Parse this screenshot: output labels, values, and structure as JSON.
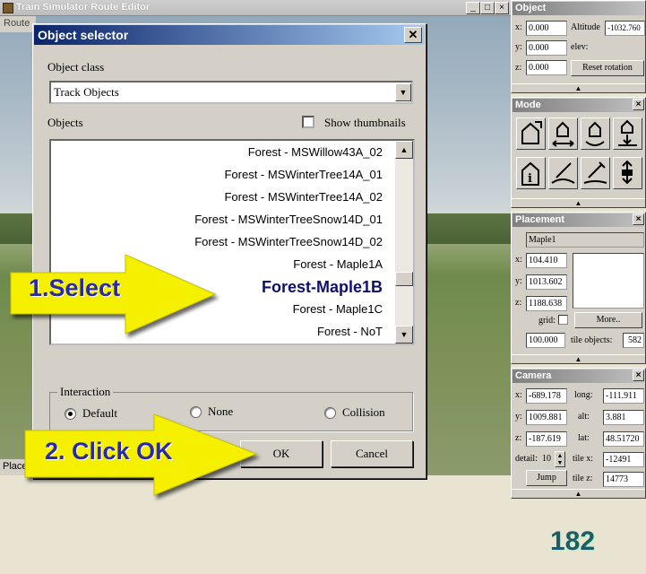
{
  "app": {
    "title": "Train Simulator Route Editor",
    "menu_first": "Route",
    "status_text": "Place"
  },
  "dialog": {
    "title": "Object selector",
    "object_class_label": "Object class",
    "object_class_value": "Track Objects",
    "objects_label": "Objects",
    "show_thumbnails_label": "Show thumbnails",
    "objects": [
      "Forest - MSWillow43A_02",
      "Forest - MSWinterTree14A_01",
      "Forest - MSWinterTree14A_02",
      "Forest - MSWinterTreeSnow14D_01",
      "Forest - MSWinterTreeSnow14D_02",
      "Forest - Maple1A",
      "Forest-Maple1B",
      "Forest - Maple1C",
      "Forest - NoT"
    ],
    "interaction_label": "Interaction",
    "interaction_options": [
      "Default",
      "None",
      "Collision"
    ],
    "interaction_selected": "Default",
    "ok_label": "OK",
    "cancel_label": "Cancel"
  },
  "callouts": {
    "step1": "1.Select",
    "step2": "2. Click OK"
  },
  "page_number": "182",
  "object_panel": {
    "title": "Object",
    "x_label": "x:",
    "x_value": "0.000",
    "y_label": "y:",
    "y_value": "0.000",
    "z_label": "z:",
    "z_value": "0.000",
    "altitude_label": "Altitude",
    "altitude_value": "-1032.760",
    "elev_label": "elev:",
    "reset_label": "Reset rotation"
  },
  "mode_panel": {
    "title": "Mode"
  },
  "placement_panel": {
    "title": "Placement",
    "name": "Maple1",
    "x_label": "x:",
    "x_value": "104.410",
    "y_label": "y:",
    "y_value": "1013.602",
    "z_label": "z:",
    "z_value": "1188.638",
    "grid_label": "grid:",
    "more_label": "More..",
    "step_value": "100.000",
    "tile_objects_label": "tile objects:",
    "tile_objects_value": "582"
  },
  "camera_panel": {
    "title": "Camera",
    "x_label": "x:",
    "x_value": "-689.178",
    "y_label": "y:",
    "y_value": "1009.881",
    "z_label": "z:",
    "z_value": "-187.619",
    "long_label": "long:",
    "long_value": "-111.911",
    "alt_label": "alt:",
    "alt_value": "3.881",
    "lat_label": "lat:",
    "lat_value": "48.51720",
    "detail_label": "detail:",
    "detail_value": "10",
    "tilex_label": "tile x:",
    "tilex_value": "-12491",
    "tilez_label": "tile z:",
    "tilez_value": "14773",
    "jump_label": "Jump"
  },
  "colors": {
    "arrow_fill": "#f4f000",
    "callout_text": "#2a2aa8",
    "titlebar": "#0a246a",
    "page_number": "#1f5a66"
  }
}
